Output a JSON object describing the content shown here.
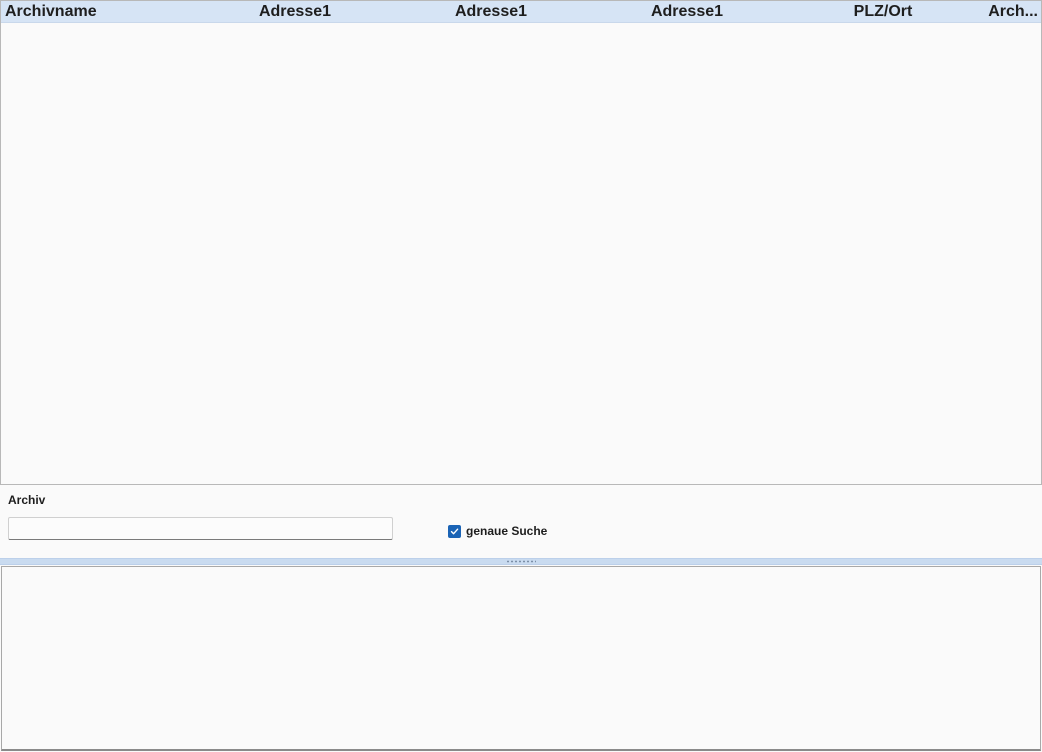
{
  "table": {
    "columns": [
      {
        "label": "Archivname"
      },
      {
        "label": "Adresse1"
      },
      {
        "label": "Adresse1"
      },
      {
        "label": "Adresse1"
      },
      {
        "label": "PLZ/Ort"
      },
      {
        "label": "Arch..."
      }
    ],
    "rows": []
  },
  "filter": {
    "archiv_label": "Archiv",
    "archiv_value": "",
    "exact_search_label": "genaue Suche",
    "exact_search_checked": true
  },
  "colors": {
    "header_bg": "#d6e4f5",
    "checkbox_accent": "#1a63b5",
    "splitter_bg": "#c9dbf0"
  },
  "icons": {
    "checkbox": "check-icon",
    "splitter": "grip-icon"
  }
}
